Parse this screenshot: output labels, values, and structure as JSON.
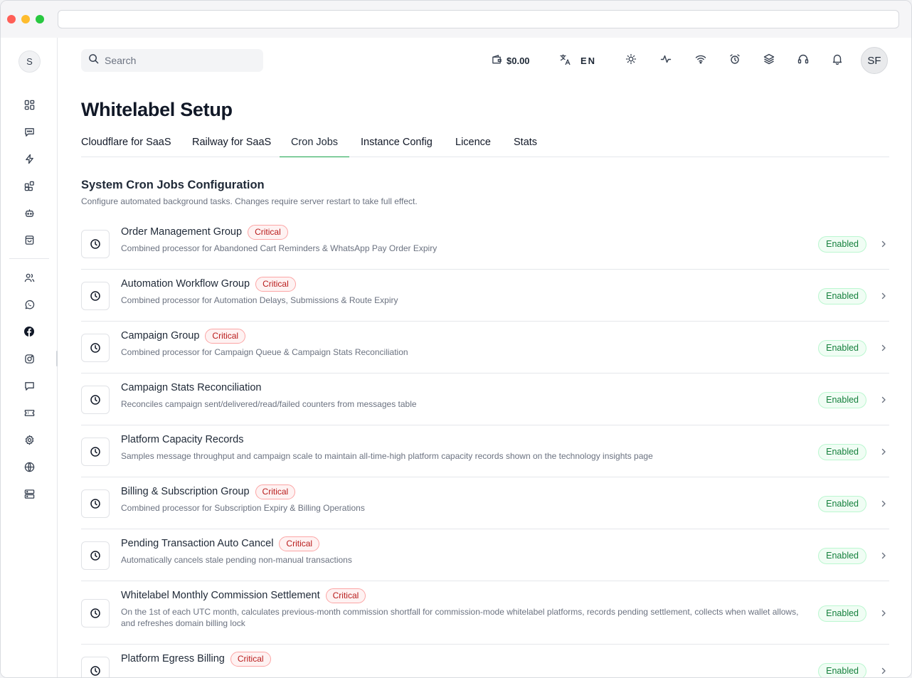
{
  "sidebar": {
    "avatar_letter": "S",
    "icons_top": [
      "dashboard-icon",
      "chat-icon",
      "bolt-icon",
      "apps-icon",
      "bot-icon",
      "shopping-bag-icon"
    ],
    "icons_bottom": [
      "users-icon",
      "whatsapp-icon",
      "facebook-icon",
      "instagram-icon",
      "message-icon",
      "ticket-icon",
      "settings-icon",
      "globe-icon",
      "server-icon"
    ]
  },
  "header": {
    "search_placeholder": "Search",
    "wallet_amount": "$0.00",
    "language": "EN",
    "user_initials": "SF"
  },
  "page": {
    "title": "Whitelabel Setup",
    "tabs": [
      {
        "label": "Cloudflare for SaaS",
        "active": false
      },
      {
        "label": "Railway for SaaS",
        "active": false
      },
      {
        "label": "Cron Jobs",
        "active": true
      },
      {
        "label": "Instance Config",
        "active": false
      },
      {
        "label": "Licence",
        "active": false
      },
      {
        "label": "Stats",
        "active": false
      }
    ],
    "section_title": "System Cron Jobs Configuration",
    "section_subtitle": "Configure automated background tasks. Changes require server restart to take full effect."
  },
  "jobs": [
    {
      "title": "Order Management Group",
      "critical": true,
      "critical_label": "Critical",
      "description": "Combined processor for Abandoned Cart Reminders & WhatsApp Pay Order Expiry",
      "status": "Enabled"
    },
    {
      "title": "Automation Workflow Group",
      "critical": true,
      "critical_label": "Critical",
      "description": "Combined processor for Automation Delays, Submissions & Route Expiry",
      "status": "Enabled"
    },
    {
      "title": "Campaign Group",
      "critical": true,
      "critical_label": "Critical",
      "description": "Combined processor for Campaign Queue & Campaign Stats Reconciliation",
      "status": "Enabled"
    },
    {
      "title": "Campaign Stats Reconciliation",
      "critical": false,
      "critical_label": "",
      "description": "Reconciles campaign sent/delivered/read/failed counters from messages table",
      "status": "Enabled"
    },
    {
      "title": "Platform Capacity Records",
      "critical": false,
      "critical_label": "",
      "description": "Samples message throughput and campaign scale to maintain all-time-high platform capacity records shown on the technology insights page",
      "status": "Enabled"
    },
    {
      "title": "Billing & Subscription Group",
      "critical": true,
      "critical_label": "Critical",
      "description": "Combined processor for Subscription Expiry & Billing Operations",
      "status": "Enabled"
    },
    {
      "title": "Pending Transaction Auto Cancel",
      "critical": true,
      "critical_label": "Critical",
      "description": "Automatically cancels stale pending non-manual transactions",
      "status": "Enabled"
    },
    {
      "title": "Whitelabel Monthly Commission Settlement",
      "critical": true,
      "critical_label": "Critical",
      "description": "On the 1st of each UTC month, calculates previous-month commission shortfall for commission-mode whitelabel platforms, records pending settlement, collects when wallet allows, and refreshes domain billing lock",
      "status": "Enabled"
    },
    {
      "title": "Platform Egress Billing",
      "critical": true,
      "critical_label": "Critical",
      "description": "",
      "status": "Enabled"
    }
  ]
}
